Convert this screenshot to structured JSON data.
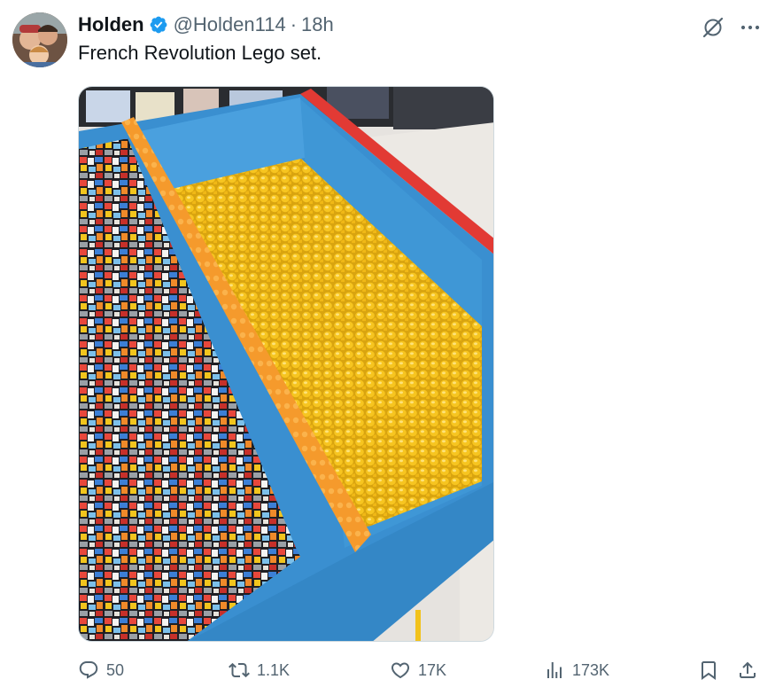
{
  "author": {
    "display_name": "Holden",
    "verified": true,
    "handle": "@Holden114",
    "separator": "·",
    "time": "18h",
    "avatar_icon": "profile-photo"
  },
  "tweet": {
    "text": "French Revolution Lego set."
  },
  "top_actions": {
    "grok_icon": "grok-icon",
    "more_icon": "more-dots-icon"
  },
  "media": {
    "type": "photo",
    "alt_subject": "bin of yellow Lego minifigure heads beside bin of headless minifigure bodies"
  },
  "actions": {
    "replies": "50",
    "reposts": "1.1K",
    "likes": "17K",
    "views": "173K",
    "bookmark_icon": "bookmark-icon",
    "share_icon": "share-icon"
  },
  "colors": {
    "accent_verified": "#1d9bf0",
    "text_primary": "#0f1419",
    "text_secondary": "#536471",
    "bin_blue": "#3a8fd0",
    "lego_yellow": "#f2c21b",
    "bar_orange": "#f5a030",
    "bin_red": "#e23a34"
  }
}
